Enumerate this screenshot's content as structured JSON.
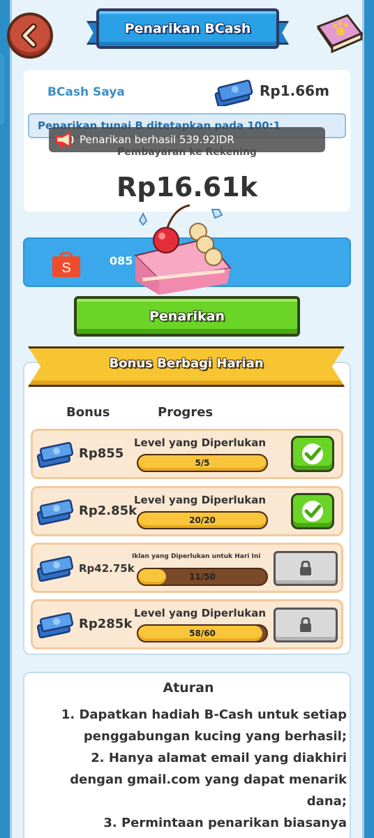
{
  "header": {
    "title": "Penarikan BCash",
    "back_icon": "chevron-left-icon",
    "book_icon": "paw-book-icon"
  },
  "balance": {
    "label": "BCash Saya",
    "value": "Rp1.66m",
    "rate_text": "Penarikan tunai B ditetapkan pada 100:1"
  },
  "toast": {
    "text": "Penarikan berhasil 539.92IDR"
  },
  "payout": {
    "label": "Pembayaran ke Rekening",
    "amount": "Rp16.61k"
  },
  "account": {
    "icon": "shopee-icon",
    "number": "085"
  },
  "withdraw_button": "Penarikan",
  "bonus": {
    "title": "Bonus Berbagi Harian",
    "col_bonus": "Bonus",
    "col_progress": "Progres",
    "rows": [
      {
        "amount": "Rp855",
        "requirement": "Level yang Diperlukan",
        "progress": "5/5",
        "fraction": 1.0,
        "status": "claimed"
      },
      {
        "amount": "Rp2.85k",
        "requirement": "Level yang Diperlukan",
        "progress": "20/20",
        "fraction": 1.0,
        "status": "claimed"
      },
      {
        "amount": "Rp42.75k",
        "requirement": "Iklan yang Diperlukan untuk Hari Ini",
        "progress": "11/50",
        "fraction": 0.22,
        "status": "locked"
      },
      {
        "amount": "Rp285k",
        "requirement": "Level yang Diperlukan",
        "progress": "58/60",
        "fraction": 0.967,
        "status": "locked"
      }
    ]
  },
  "rules": {
    "title": "Aturan",
    "lines": [
      "1. Dapatkan hadiah B-Cash untuk setiap penggabungan kucing yang berhasil;",
      "2. Hanya alamat email yang diakhiri dengan gmail.com yang dapat menarik dana;",
      "3. Permintaan penarikan biasanya"
    ]
  },
  "colors": {
    "accent_blue": "#2aa0e6",
    "green": "#6ad427",
    "gold": "#f9c53b",
    "shopee": "#ee4d2d"
  }
}
